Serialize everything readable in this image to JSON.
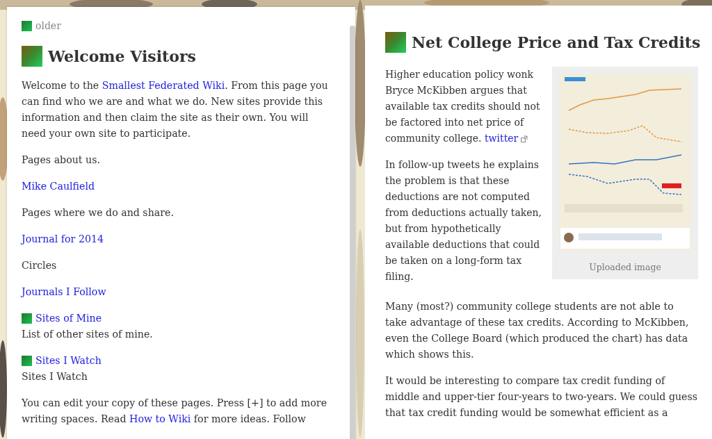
{
  "left_page": {
    "older_link": "older",
    "title": "Welcome Visitors",
    "items": [
      {
        "kind": "paragraph",
        "parts": [
          {
            "text": "Welcome to the ",
            "link": false
          },
          {
            "text": "Smallest Federated Wiki",
            "link": true
          },
          {
            "text": ". From this page you can find who we are and what we do. New sites provide this information and then claim the site as their own. You will need your own site to participate.",
            "link": false
          }
        ]
      },
      {
        "kind": "text",
        "text": "Pages about us."
      },
      {
        "kind": "link",
        "text": "Mike Caulfield"
      },
      {
        "kind": "text",
        "text": "Pages where we do and share."
      },
      {
        "kind": "link",
        "text": "Journal for 2014"
      },
      {
        "kind": "text",
        "text": "Circles"
      },
      {
        "kind": "link",
        "text": "Journals I Follow"
      },
      {
        "kind": "reference",
        "text": "Sites of Mine",
        "description": "List of other sites of mine."
      },
      {
        "kind": "reference",
        "text": "Sites I Watch",
        "description": "Sites I Watch"
      },
      {
        "kind": "paragraph",
        "parts": [
          {
            "text": "You can edit your copy of these pages. Press [+] to add more writing spaces. Read ",
            "link": false
          },
          {
            "text": "How to Wiki",
            "link": true
          },
          {
            "text": " for more ideas. Follow",
            "link": false
          }
        ]
      }
    ]
  },
  "right_page": {
    "title": "Net College Price and Tax Credits",
    "image": {
      "kind": "picture",
      "caption": "Uploaded image"
    },
    "items": [
      {
        "kind": "paragraph",
        "parts": [
          {
            "text": "Higher education policy wonk Bryce McKibben argues that available tax credits should not be factored into net price of community college. ",
            "link": false
          },
          {
            "text": "twitter",
            "link": true,
            "external": true
          }
        ]
      },
      {
        "kind": "paragraph",
        "parts": [
          {
            "text": "In follow-up tweets he explains the problem is that these deductions are not computed from deductions actually taken, but from hypothetically available deductions that could be taken on a long-form tax filing.",
            "link": false
          }
        ]
      },
      {
        "kind": "paragraph",
        "parts": [
          {
            "text": "Many (most?) community college students are not able to take advantage of these tax credits. According to McKibben, even the College Board (which produced the chart) has data which shows this.",
            "link": false
          }
        ]
      },
      {
        "kind": "paragraph",
        "parts": [
          {
            "text": "It would be interesting to compare tax credit funding of middle and upper-tier four-years to two-years. We could guess that tax credit funding would be somewhat efficient as a",
            "link": false
          }
        ]
      }
    ]
  }
}
